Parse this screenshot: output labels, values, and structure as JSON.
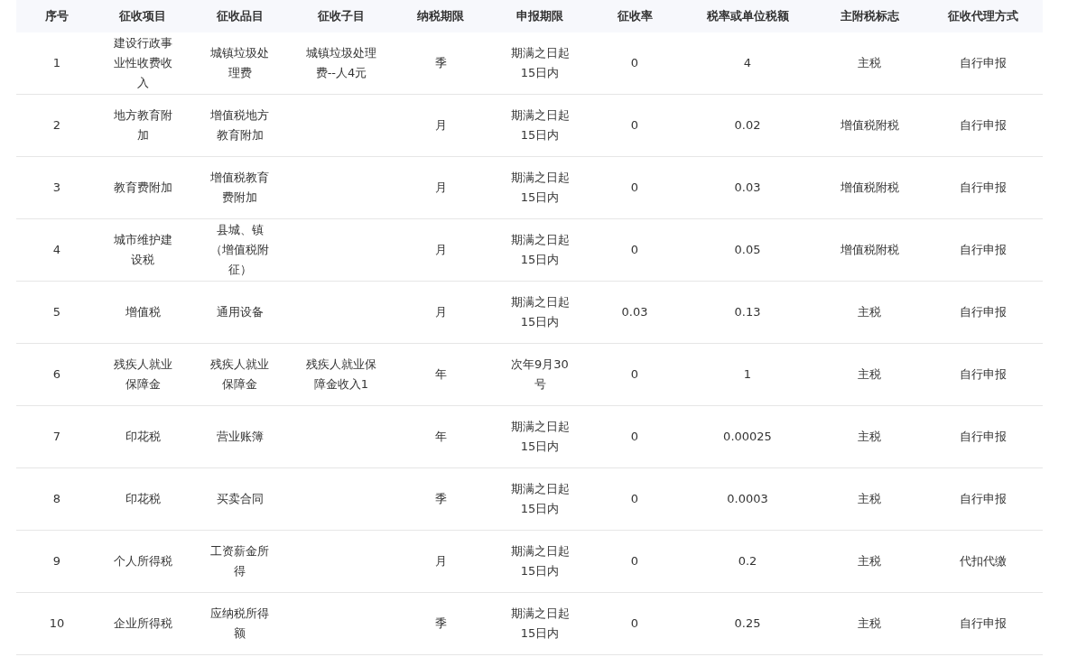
{
  "table": {
    "columns": [
      "序号",
      "征收项目",
      "征收品目",
      "征收子目",
      "纳税期限",
      "申报期限",
      "征收率",
      "税率或单位税额",
      "主附税标志",
      "征收代理方式"
    ],
    "rows": [
      [
        "1",
        "建设行政事业性收费收入",
        "城镇垃圾处理费",
        "城镇垃圾处理费--人4元",
        "季",
        "期满之日起15日内",
        "0",
        "4",
        "主税",
        "自行申报"
      ],
      [
        "2",
        "地方教育附加",
        "增值税地方教育附加",
        "",
        "月",
        "期满之日起15日内",
        "0",
        "0.02",
        "增值税附税",
        "自行申报"
      ],
      [
        "3",
        "教育费附加",
        "增值税教育费附加",
        "",
        "月",
        "期满之日起15日内",
        "0",
        "0.03",
        "增值税附税",
        "自行申报"
      ],
      [
        "4",
        "城市维护建设税",
        "县城、镇（增值税附征）",
        "",
        "月",
        "期满之日起15日内",
        "0",
        "0.05",
        "增值税附税",
        "自行申报"
      ],
      [
        "5",
        "增值税",
        "通用设备",
        "",
        "月",
        "期满之日起15日内",
        "0.03",
        "0.13",
        "主税",
        "自行申报"
      ],
      [
        "6",
        "残疾人就业保障金",
        "残疾人就业保障金",
        "残疾人就业保障金收入1",
        "年",
        "次年9月30号",
        "0",
        "1",
        "主税",
        "自行申报"
      ],
      [
        "7",
        "印花税",
        "营业账簿",
        "",
        "年",
        "期满之日起15日内",
        "0",
        "0.00025",
        "主税",
        "自行申报"
      ],
      [
        "8",
        "印花税",
        "买卖合同",
        "",
        "季",
        "期满之日起15日内",
        "0",
        "0.0003",
        "主税",
        "自行申报"
      ],
      [
        "9",
        "个人所得税",
        "工资薪金所得",
        "",
        "月",
        "期满之日起15日内",
        "0",
        "0.2",
        "主税",
        "代扣代缴"
      ],
      [
        "10",
        "企业所得税",
        "应纳税所得额",
        "",
        "季",
        "期满之日起15日内",
        "0",
        "0.25",
        "主税",
        "自行申报"
      ]
    ]
  }
}
